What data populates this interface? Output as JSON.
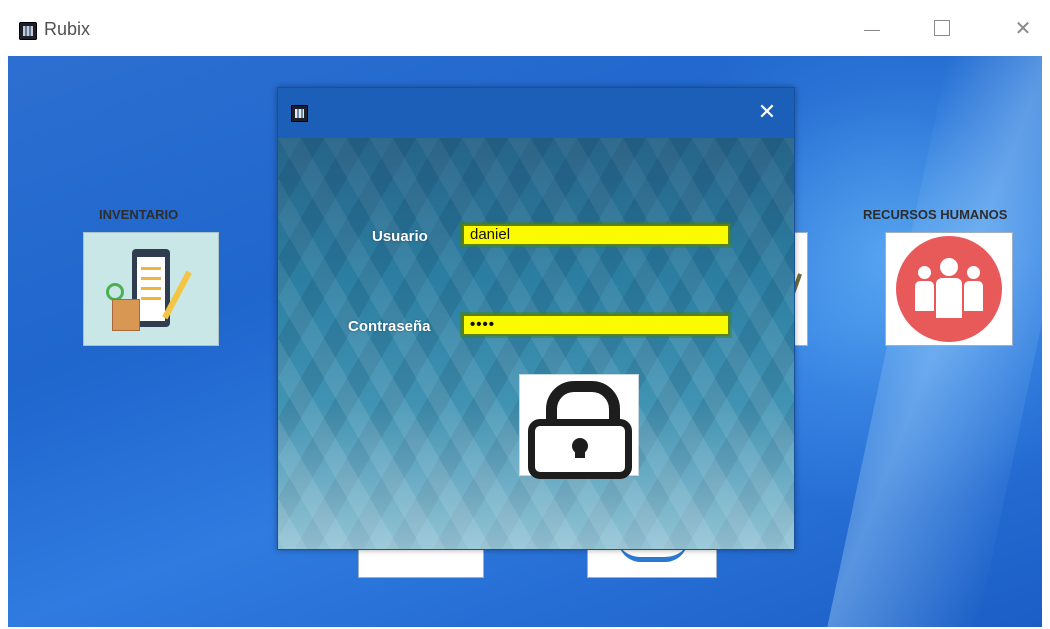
{
  "window": {
    "title": "Rubix",
    "icon": "rubix-app-icon",
    "controls": {
      "minimize_icon": "minimize-icon",
      "maximize_icon": "maximize-icon",
      "close_icon": "close-icon",
      "close_glyph": "✕"
    }
  },
  "desktop": {
    "modules": [
      {
        "label": "INVENTARIO",
        "icon": "inventory-clipboard-icon"
      },
      {
        "label": "RECURSOS HUMANOS",
        "icon": "people-group-icon"
      }
    ]
  },
  "login_dialog": {
    "icon": "rubix-app-icon",
    "close_glyph": "✕",
    "username_label": "Usuario",
    "username_value": "daniel",
    "password_label": "Contraseña",
    "password_value": "••••",
    "submit_icon": "lock-icon"
  },
  "colors": {
    "desktop_blue": "#1f66cd",
    "dialog_titlebar": "#1b5fb8",
    "input_fill": "#fbfb00",
    "input_border": "#5a7f1f",
    "hr_icon_red": "#e85a5a"
  }
}
